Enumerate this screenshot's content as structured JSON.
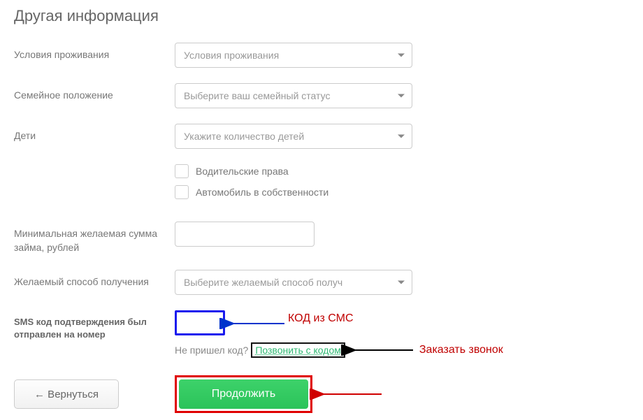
{
  "title": "Другая информация",
  "fields": {
    "living": {
      "label": "Условия проживания",
      "placeholder": "Условия проживания"
    },
    "marital": {
      "label": "Семейное положение",
      "placeholder": "Выберите ваш семейный статус"
    },
    "children": {
      "label": "Дети",
      "placeholder": "Укажите количество детей"
    },
    "license": {
      "label": "Водительские права"
    },
    "car": {
      "label": "Автомобиль в собственности"
    },
    "min_amount": {
      "label": "Минимальная желаемая сумма займа, рублей"
    },
    "method": {
      "label": "Желаемый способ получения",
      "placeholder": "Выберите желаемый способ получ"
    },
    "sms": {
      "label": "SMS код подтверждения был отправлен на номер"
    }
  },
  "sms_block": {
    "no_code_text": "Не пришел код?",
    "call_link": "Позвонить с кодом"
  },
  "annotations": {
    "sms_arrow": "КОД из СМС",
    "call_arrow": "Заказать звонок"
  },
  "buttons": {
    "back": "← Вернуться",
    "continue": "Продолжить"
  }
}
